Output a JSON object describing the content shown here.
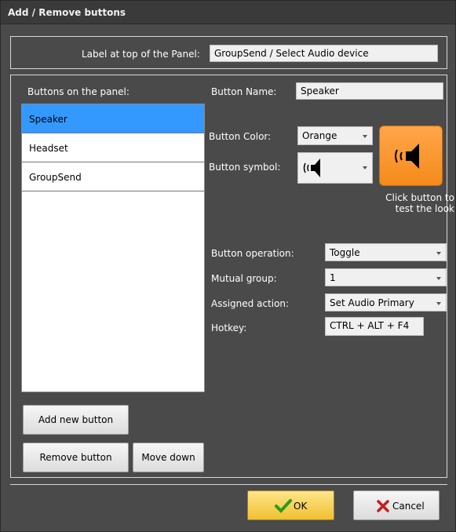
{
  "dialog": {
    "title": "Add / Remove buttons"
  },
  "panel_label": {
    "label": "Label at top of the Panel:",
    "value": "GroupSend / Select Audio device"
  },
  "buttons_list": {
    "header": "Buttons on the panel:",
    "items": [
      {
        "label": "Speaker",
        "selected": true
      },
      {
        "label": "Headset",
        "selected": false
      },
      {
        "label": "GroupSend",
        "selected": false
      }
    ]
  },
  "left_actions": {
    "add": "Add new button",
    "remove": "Remove button",
    "move_down": "Move down"
  },
  "properties": {
    "button_name_label": "Button Name:",
    "button_name_value": "Speaker",
    "button_color_label": "Button Color:",
    "button_color_value": "Orange",
    "button_symbol_label": "Button symbol:",
    "symbol_icon": "speaker-icon",
    "preview_hint": "Click button to test the look",
    "operation_label": "Button operation:",
    "operation_value": "Toggle",
    "mutual_group_label": "Mutual group:",
    "mutual_group_value": "1",
    "assigned_action_label": "Assigned action:",
    "assigned_action_value": "Set Audio Primary",
    "hotkey_label": "Hotkey:",
    "hotkey_value": "CTRL + ALT + F4"
  },
  "footer": {
    "ok": "OK",
    "cancel": "Cancel"
  },
  "colors": {
    "background": "#4a4a4a",
    "selection": "#3399ff",
    "preview_button": "#f58a1a",
    "ok_button": "#f0c030"
  }
}
